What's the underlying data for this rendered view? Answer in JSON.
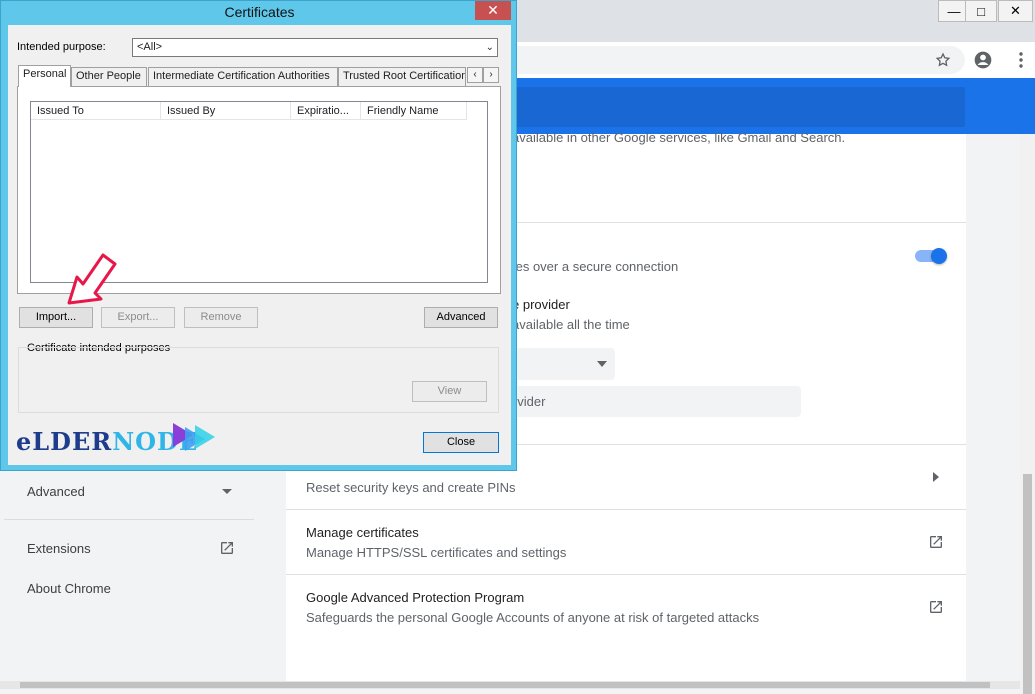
{
  "browser": {
    "minimize_glyph": "—",
    "maximize_glyph": "□",
    "close_glyph": "✕",
    "bookmark_icon": "star-icon",
    "profile_icon": "account-icon",
    "menu_icon": "kebab-icon"
  },
  "settings": {
    "sidebar": {
      "advanced_label": "Advanced",
      "extensions_label": "Extensions",
      "about_label": "About Chrome"
    },
    "partial_text_1": "available in other Google services, like Gmail and Search.",
    "secure_dns_desc": "tes over a secure connection",
    "provider_label": "e provider",
    "provider_desc": "available all the time",
    "custom_provider_placeholder": "ovider",
    "security_keys_desc": "Reset security keys and create PINs",
    "manage_certs_title": "Manage certificates",
    "manage_certs_desc": "Manage HTTPS/SSL certificates and settings",
    "gapp_title": "Google Advanced Protection Program",
    "gapp_desc": "Safeguards the personal Google Accounts of anyone at risk of targeted attacks",
    "secure_dns_enabled": true
  },
  "dialog": {
    "title": "Certificates",
    "close_glyph": "✕",
    "intended_purpose_label": "Intended purpose:",
    "intended_purpose_value": "<All>",
    "tabs": [
      {
        "label": "Personal",
        "active": true
      },
      {
        "label": "Other People",
        "active": false
      },
      {
        "label": "Intermediate Certification Authorities",
        "active": false
      },
      {
        "label": "Trusted Root Certification",
        "active": false
      }
    ],
    "columns": [
      "Issued To",
      "Issued By",
      "Expiratio...",
      "Friendly Name"
    ],
    "buttons": {
      "import": "Import...",
      "export": "Export...",
      "remove": "Remove",
      "advanced": "Advanced",
      "view": "View",
      "close": "Close"
    },
    "purposes_group_label": "Certificate intended purposes"
  },
  "watermark": {
    "logo_text": "eldernode",
    "logo_colors": {
      "elder": "#1e3c8c",
      "node": "#2fb5e8"
    }
  },
  "colors": {
    "chrome_blue": "#1a73e8",
    "dialog_frame": "#5fc8ea",
    "close_red": "#c75050",
    "arrow_red": "#e8174a"
  }
}
